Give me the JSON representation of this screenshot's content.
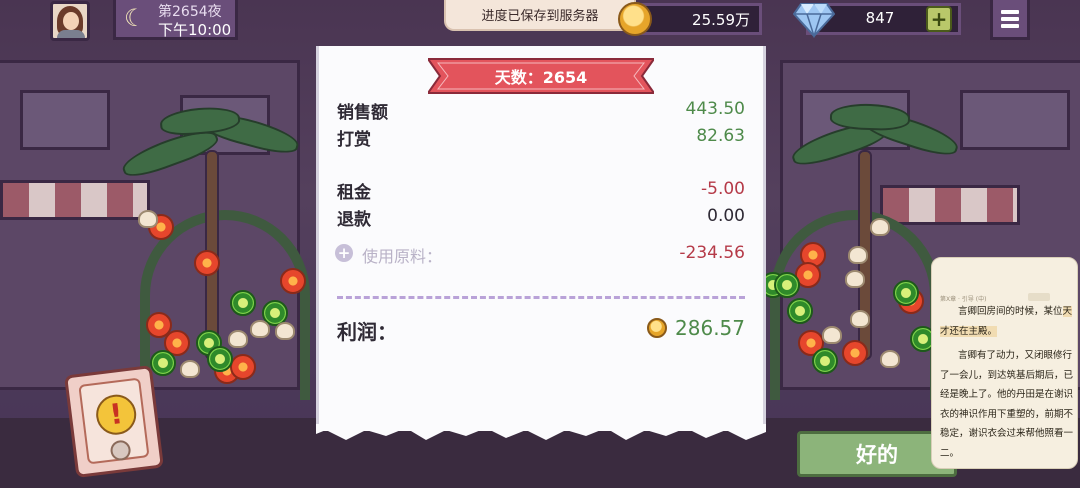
{
  "hud": {
    "day_label": "第2654夜",
    "time_label": "下午10:00",
    "coins": "25.59万",
    "gems": "847",
    "plus_label": "+"
  },
  "toast": {
    "message": "进度已保存到服务器"
  },
  "receipt": {
    "title": "天数：2654",
    "rows": [
      {
        "label": "销售额",
        "value": "443.50"
      },
      {
        "label": "打赏",
        "value": "82.63"
      },
      {
        "label": "租金",
        "value": "-5.00"
      },
      {
        "label": "退款",
        "value": "0.00"
      }
    ],
    "materials": {
      "label": "使用原料：",
      "value": "-234.56",
      "icon": "plus-circle-icon"
    },
    "profit": {
      "label": "利润：",
      "value": "286.57",
      "icon": "coin-icon"
    }
  },
  "ok_button": {
    "label": "好的"
  },
  "phone": {
    "icon": "alert-icon",
    "symbol": "!"
  },
  "reader": {
    "header_left": "第X章 · 引导 (中)",
    "paragraphs": [
      {
        "lead": "言卿回房间的时候，某位",
        "tail": "天才还在主殿。"
      },
      {
        "text": "言卿有了动力，又闭眼修行了一会儿，到达筑基后期后，已经是晚上了。他的丹田是在谢识衣的神识作用下重塑的，前期不稳定，谢识衣会过来帮他照看一二。"
      }
    ]
  },
  "colors": {
    "hud_panel": "#6a4e7a",
    "banner_red": "#e3545c",
    "positive": "#4e8a4a",
    "negative": "#b53a48",
    "ok_green": "#8cb47a"
  }
}
